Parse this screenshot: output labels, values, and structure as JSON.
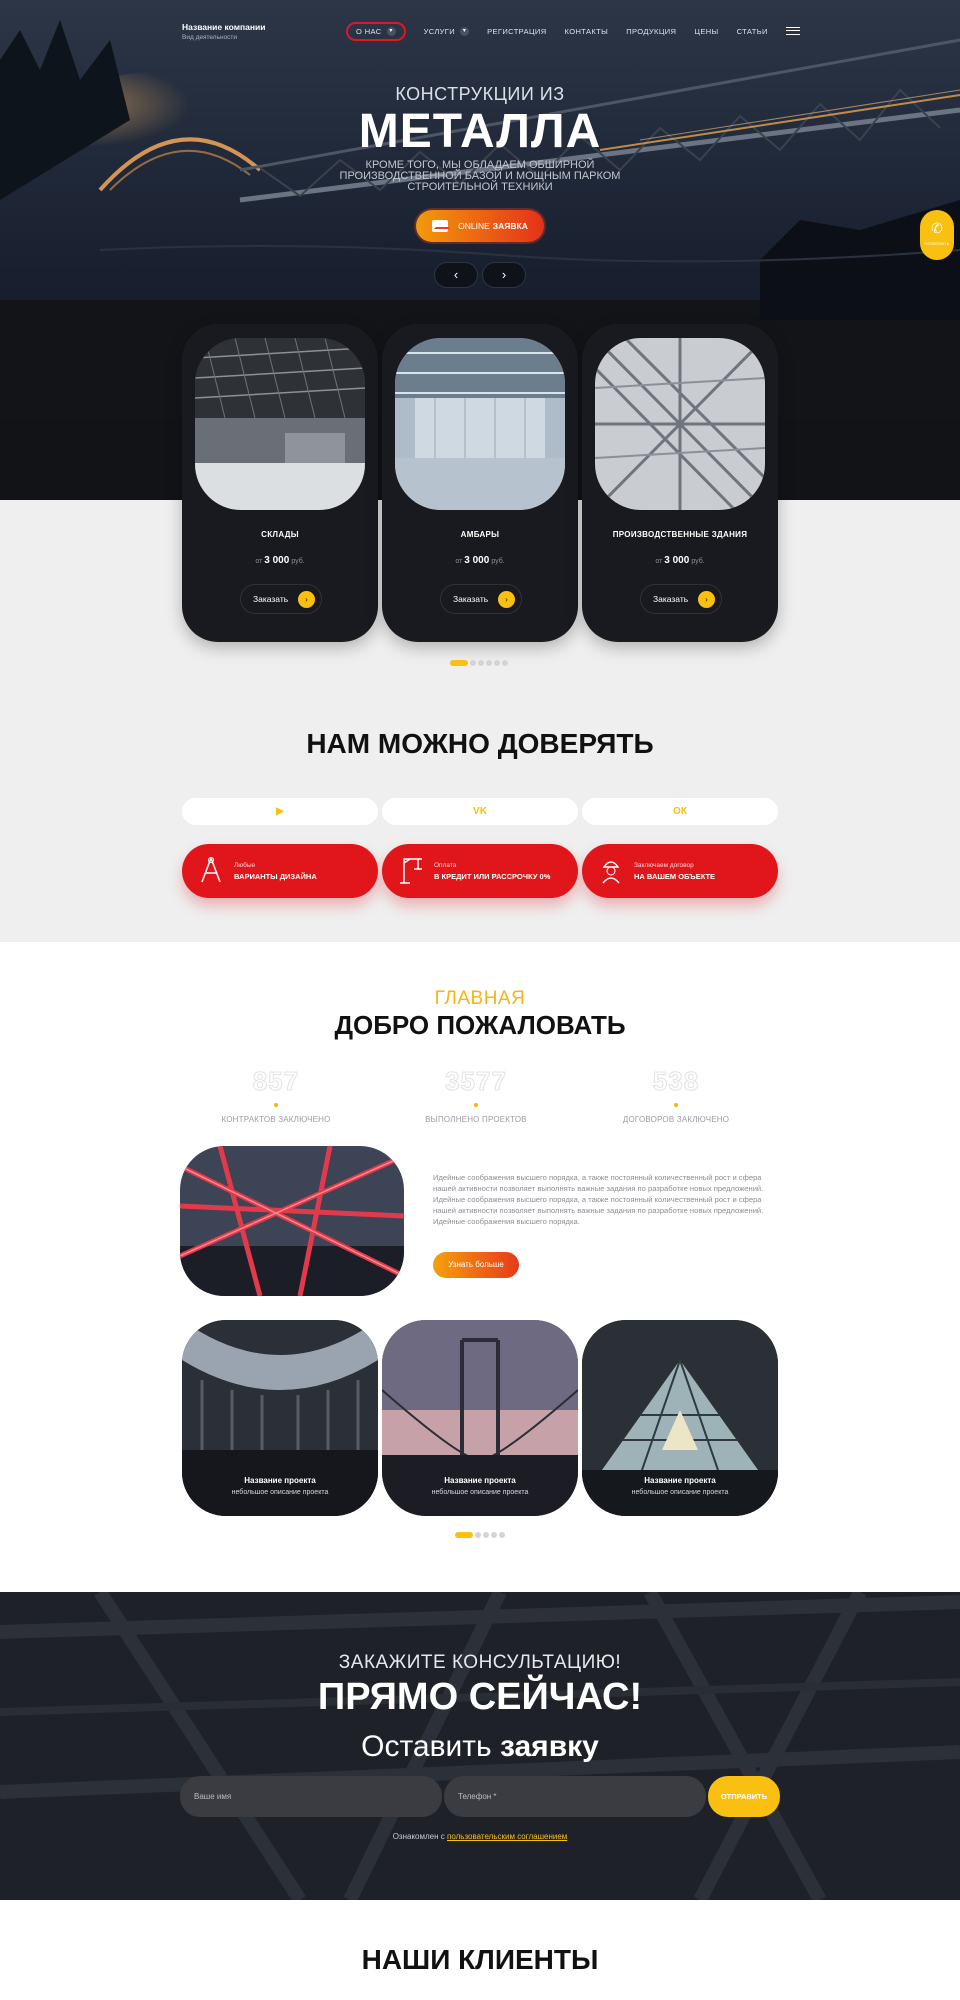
{
  "header": {
    "company_name": "Название компании",
    "company_sub": "Вид деятельности",
    "menu": [
      {
        "label": "О НАС",
        "has_dropdown": true,
        "active": true
      },
      {
        "label": "УСЛУГИ",
        "has_dropdown": true,
        "active": false
      },
      {
        "label": "РЕГИСТРАЦИЯ",
        "has_dropdown": false,
        "active": false
      },
      {
        "label": "КОНТАКТЫ",
        "has_dropdown": false,
        "active": false
      },
      {
        "label": "ПРОДУКЦИЯ",
        "has_dropdown": false,
        "active": false
      },
      {
        "label": "ЦЕНЫ",
        "has_dropdown": false,
        "active": false
      },
      {
        "label": "СТАТЬИ",
        "has_dropdown": false,
        "active": false
      }
    ]
  },
  "hero": {
    "subtitle": "КОНСТРУКЦИИ ИЗ",
    "title": "МЕТАЛЛА",
    "description": "КРОМЕ ТОГО, МЫ ОБЛАДАЕМ ОБШИРНОЙ ПРОИЗВОДСТВЕННОЙ БАЗОЙ И МОЩНЫМ ПАРКОМ СТРОИТЕЛЬНОЙ ТЕХНИКИ",
    "cta_prefix": "ONLINE",
    "cta_bold": "ЗАЯВКА",
    "prev_arrow": "‹",
    "next_arrow": "›",
    "phone_label": "ПОЗВОНИТЬ"
  },
  "products": {
    "items": [
      {
        "name": "СКЛАДЫ",
        "price_prefix": "от",
        "price": "3 000",
        "price_suffix": "руб.",
        "order_label": "Заказать"
      },
      {
        "name": "АМБАРЫ",
        "price_prefix": "от",
        "price": "3 000",
        "price_suffix": "руб.",
        "order_label": "Заказать"
      },
      {
        "name": "ПРОИЗВОДСТВЕННЫЕ ЗДАНИЯ",
        "price_prefix": "от",
        "price": "3 000",
        "price_suffix": "руб.",
        "order_label": "Заказать"
      }
    ],
    "pager_count": 6,
    "pager_active": 0
  },
  "trust": {
    "title": "НАМ МОЖНО ДОВЕРЯТЬ",
    "socials": [
      {
        "icon": "youtube-icon",
        "glyph": "▶"
      },
      {
        "icon": "vk-icon",
        "glyph": "VK"
      },
      {
        "icon": "odnoklassniki-icon",
        "glyph": "ОК"
      }
    ],
    "features": [
      {
        "icon": "compass-icon",
        "line1": "Любые",
        "line2": "ВАРИАНТЫ ДИЗАЙНА"
      },
      {
        "icon": "crane-icon",
        "line1": "Оплата",
        "line2": "В КРЕДИТ ИЛИ РАССРОЧКУ 0%"
      },
      {
        "icon": "worker-icon",
        "line1": "Заключаем договор",
        "line2": "НА ВАШЕМ ОБЪЕКТЕ"
      }
    ]
  },
  "welcome": {
    "kicker": "ГЛАВНАЯ",
    "title": "ДОБРО ПОЖАЛОВАТЬ",
    "stats": [
      {
        "value": "857",
        "label": "КОНТРАКТОВ ЗАКЛЮЧЕНО"
      },
      {
        "value": "3577",
        "label": "ВЫПОЛНЕНО ПРОЕКТОВ"
      },
      {
        "value": "538",
        "label": "ДОГОВОРОВ ЗАКЛЮЧЕНО"
      }
    ],
    "text": "Идейные соображения высшего порядка, а также постоянный количественный рост и сфера нашей активности позволяет выполнять важные задания по разработке новых предложений. Идейные соображения высшего порядка, а также постоянный количественный рост и сфера нашей активности позволяет выполнять важные задания по разработке новых предложений. Идейные соображения высшего порядка.",
    "more_label": "Узнать больше"
  },
  "projects": {
    "items": [
      {
        "title": "Название проекта",
        "desc": "небольшое описание проекта"
      },
      {
        "title": "Название проекта",
        "desc": "небольшое описание проекта"
      },
      {
        "title": "Название проекта",
        "desc": "небольшое описание проекта"
      }
    ],
    "pager_count": 5,
    "pager_active": 0
  },
  "consult": {
    "line1": "ЗАКАЖИТЕ КОНСУЛЬТАЦИЮ!",
    "line2": "ПРЯМО СЕЙЧАС!",
    "line3_prefix": "Оставить",
    "line3_bold": "заявку",
    "name_placeholder": "Ваше имя",
    "phone_placeholder": "Телефон *",
    "submit_label": "ОТПРАВИТЬ",
    "agree_prefix": "Ознакомлен с",
    "agree_link": "пользовательским соглашением"
  },
  "clients": {
    "title": "НАШИ КЛИЕНТЫ"
  },
  "colors": {
    "accent_yellow": "#f9c012",
    "accent_red": "#e0161b",
    "accent_orange": "#e5311a",
    "dark": "#191a1f"
  }
}
